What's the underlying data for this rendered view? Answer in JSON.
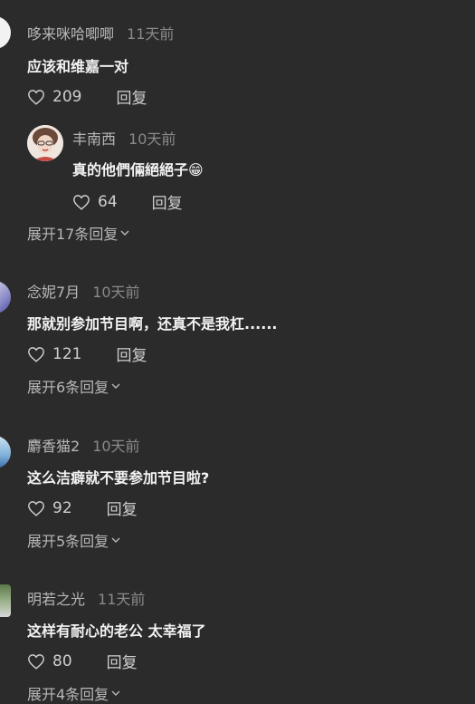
{
  "comments": [
    {
      "author": "哆来咪哈唧唧",
      "time": "11天前",
      "text": "应该和维嘉一对",
      "likes": "209",
      "reply_label": "回复",
      "reply": {
        "author": "丰南西",
        "time": "10天前",
        "text": "真的他們倆絕絕子",
        "emoji": "😁",
        "likes": "64",
        "reply_label": "回复"
      },
      "expand_label": "展开17条回复"
    },
    {
      "author": "念妮7月",
      "time": "10天前",
      "text": "那就别参加节目啊，还真不是我杠......",
      "likes": "121",
      "reply_label": "回复",
      "expand_label": "展开6条回复"
    },
    {
      "author": "麝香猫2",
      "time": "10天前",
      "text": "这么洁癖就不要参加节目啦?",
      "likes": "92",
      "reply_label": "回复",
      "expand_label": "展开5条回复"
    },
    {
      "author": "明若之光",
      "time": "11天前",
      "text": "这样有耐心的老公 太幸福了",
      "likes": "80",
      "reply_label": "回复",
      "expand_label": "展开4条回复"
    }
  ],
  "icons": {
    "like": "heart-outline-icon",
    "expand": "chevron-down-icon"
  },
  "colors": {
    "background": "#2b2b2b",
    "primary_text": "#f2f2f2",
    "secondary_text": "#8a8a8a"
  }
}
